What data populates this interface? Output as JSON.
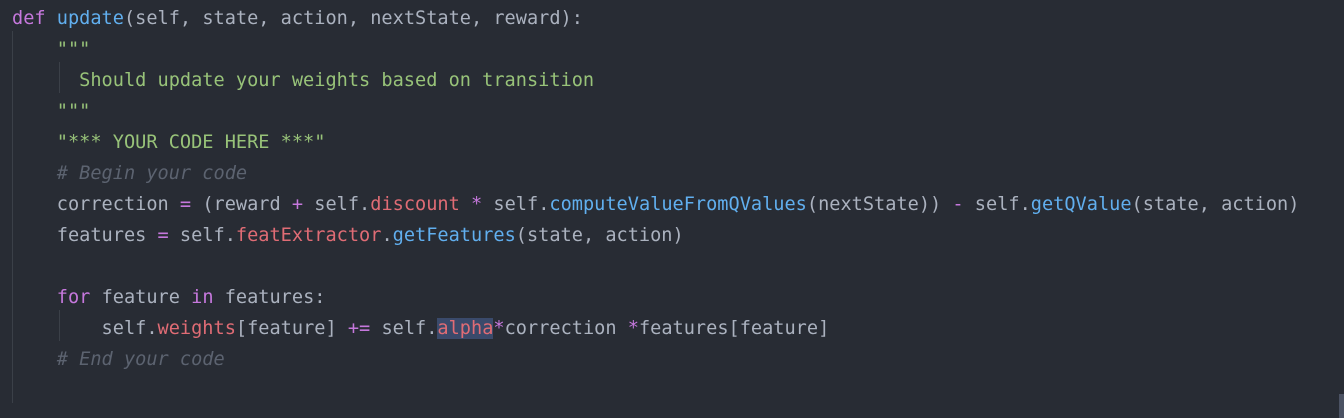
{
  "code": {
    "lines": [
      [
        {
          "t": "def ",
          "c": "kw"
        },
        {
          "t": "update",
          "c": "fn"
        },
        {
          "t": "(self, state, action, nextState, reward):",
          "c": "plain"
        }
      ],
      [
        {
          "t": "    \"\"\"",
          "c": "str"
        }
      ],
      [
        {
          "t": "      Should update your weights based on transition",
          "c": "str"
        }
      ],
      [
        {
          "t": "    \"\"\"",
          "c": "str"
        }
      ],
      [
        {
          "t": "    \"*** YOUR CODE HERE ***\"",
          "c": "str"
        }
      ],
      [
        {
          "t": "    # Begin your code",
          "c": "cmt"
        }
      ],
      [
        {
          "t": "    correction ",
          "c": "plain"
        },
        {
          "t": "=",
          "c": "op"
        },
        {
          "t": " (reward ",
          "c": "plain"
        },
        {
          "t": "+",
          "c": "op"
        },
        {
          "t": " self.",
          "c": "plain"
        },
        {
          "t": "discount",
          "c": "attr"
        },
        {
          "t": " ",
          "c": "plain"
        },
        {
          "t": "*",
          "c": "op"
        },
        {
          "t": " self.",
          "c": "plain"
        },
        {
          "t": "computeValueFromQValues",
          "c": "fn"
        },
        {
          "t": "(nextState)) ",
          "c": "plain"
        },
        {
          "t": "-",
          "c": "op"
        },
        {
          "t": " self.",
          "c": "plain"
        },
        {
          "t": "getQValue",
          "c": "fn"
        },
        {
          "t": "(state, action)",
          "c": "plain"
        }
      ],
      [
        {
          "t": "    features ",
          "c": "plain"
        },
        {
          "t": "=",
          "c": "op"
        },
        {
          "t": " self.",
          "c": "plain"
        },
        {
          "t": "featExtractor",
          "c": "attr"
        },
        {
          "t": ".",
          "c": "plain"
        },
        {
          "t": "getFeatures",
          "c": "fn"
        },
        {
          "t": "(state, action)",
          "c": "plain"
        }
      ],
      [],
      [
        {
          "t": "    ",
          "c": "plain"
        },
        {
          "t": "for",
          "c": "kw"
        },
        {
          "t": " feature ",
          "c": "plain"
        },
        {
          "t": "in",
          "c": "kw"
        },
        {
          "t": " features:",
          "c": "plain"
        }
      ],
      [
        {
          "t": "        self.",
          "c": "plain"
        },
        {
          "t": "weights",
          "c": "attr"
        },
        {
          "t": "[feature] ",
          "c": "plain"
        },
        {
          "t": "+=",
          "c": "op"
        },
        {
          "t": " self.",
          "c": "plain"
        },
        {
          "t": "alpha",
          "c": "attr",
          "sel": true
        },
        {
          "t": "*",
          "c": "op"
        },
        {
          "t": "correction ",
          "c": "plain"
        },
        {
          "t": "*",
          "c": "op"
        },
        {
          "t": "features[feature]",
          "c": "plain"
        }
      ],
      [
        {
          "t": "    # End your code",
          "c": "cmt"
        }
      ]
    ]
  },
  "colors": {
    "background": "#282c34",
    "keyword": "#c678dd",
    "function": "#61afef",
    "string": "#98c379",
    "comment": "#5c6370",
    "attribute": "#e06c75",
    "plain": "#abb2bf",
    "selection": "#3a4a6b"
  }
}
